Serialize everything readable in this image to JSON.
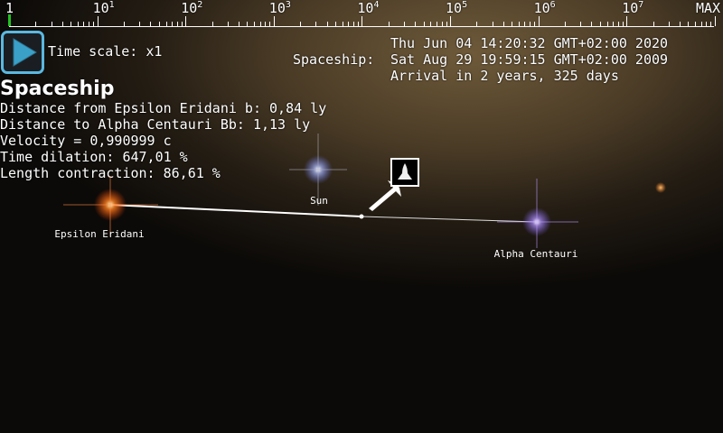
{
  "timeline": {
    "labels": [
      {
        "base": "1",
        "exp": ""
      },
      {
        "base": "10",
        "exp": "1"
      },
      {
        "base": "10",
        "exp": "2"
      },
      {
        "base": "10",
        "exp": "3"
      },
      {
        "base": "10",
        "exp": "4"
      },
      {
        "base": "10",
        "exp": "5"
      },
      {
        "base": "10",
        "exp": "6"
      },
      {
        "base": "10",
        "exp": "7"
      }
    ],
    "max_label": "MAX",
    "marker_color": "#22c022"
  },
  "play_button": {
    "icon": "play-icon",
    "color": "#4ab0d8"
  },
  "time_scale": "Time scale: x1",
  "dates": {
    "now": "Thu Jun 04 14:20:32 GMT+02:00 2020",
    "spaceship_label": "Spaceship:",
    "spaceship": "Sat Aug 29 19:59:15 GMT+02:00 2009",
    "arrival": "Arrival in 2 years, 325 days"
  },
  "info": {
    "title": "Spaceship",
    "lines": [
      "Distance from Epsilon Eridani b: 0,84 ly",
      "Distance to Alpha Centauri Bb: 1,13 ly",
      "Velocity = 0,990999 c",
      "Time dilation: 647,01 %",
      "Length contraction: 86,61 %"
    ]
  },
  "stars": {
    "sun": "Sun",
    "epsilon": "Epsilon Eridani",
    "alpha": "Alpha Centauri"
  },
  "colors": {
    "sun": "#c8d4ff",
    "epsilon": "#ff8a20",
    "alpha": "#c8b4ff"
  }
}
